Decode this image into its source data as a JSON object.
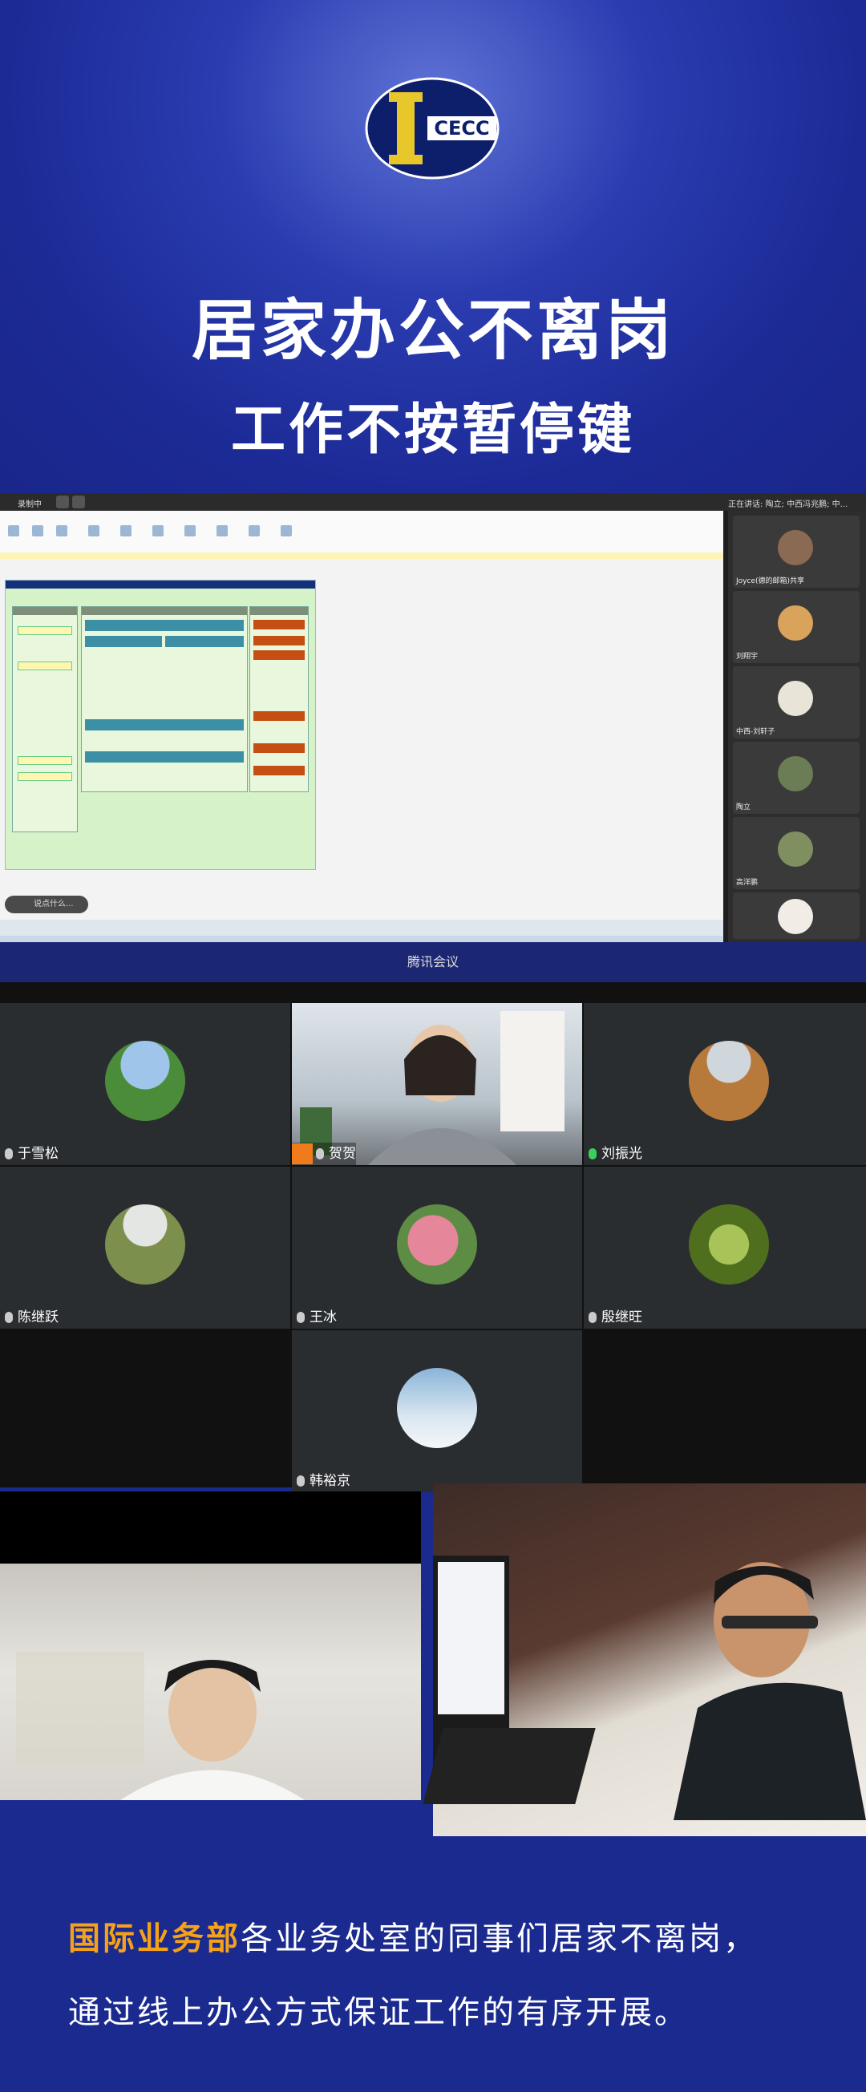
{
  "hero": {
    "logo_text": "CECC",
    "title_line1": "居家办公不离岗",
    "title_line2": "工作不按暂停键"
  },
  "screen": {
    "recording_label": "录制中",
    "speaking_label": "正在讲话: 陶立; 中西冯兆鹏; 中...",
    "search_placeholder": "说点什么...",
    "participants": [
      {
        "name": "Joyce(德的邮箱)共享"
      },
      {
        "name": "刘翔宇"
      },
      {
        "name": "中西-刘轩子"
      },
      {
        "name": "陶立"
      },
      {
        "name": "高洋鹏"
      },
      {
        "name": ""
      }
    ]
  },
  "meeting": {
    "window_title": "腾讯会议",
    "tiles": [
      {
        "name": "于雪松",
        "type": "avatar",
        "color": "#4b8c3b"
      },
      {
        "name": "贺贺",
        "type": "video",
        "color": "#c9d3dc"
      },
      {
        "name": "刘振光",
        "type": "avatar",
        "color": "#b87a3a"
      },
      {
        "name": "陈继跃",
        "type": "avatar",
        "color": "#7d8f4d"
      },
      {
        "name": "王冰",
        "type": "avatar",
        "color": "#e6869a"
      },
      {
        "name": "殷继旺",
        "type": "avatar",
        "color": "#6f8f2a"
      },
      {
        "name": "韩裕京",
        "type": "avatar",
        "color": "#8ab4d8"
      }
    ]
  },
  "caption": {
    "highlight": "国际业务部",
    "line1_rest": "各业务处室的同事们居家不离岗，",
    "line2": "通过线上办公方式保证工作的有序开展。"
  }
}
